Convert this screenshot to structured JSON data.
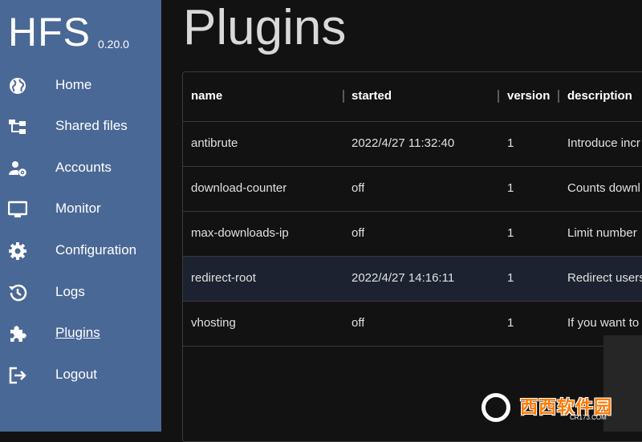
{
  "app": {
    "name": "HFS",
    "version": "0.20.0"
  },
  "sidebar": {
    "items": [
      {
        "label": "Home",
        "icon": "globe-icon"
      },
      {
        "label": "Shared files",
        "icon": "file-tree-icon"
      },
      {
        "label": "Accounts",
        "icon": "account-gear-icon"
      },
      {
        "label": "Monitor",
        "icon": "monitor-icon"
      },
      {
        "label": "Configuration",
        "icon": "gear-icon"
      },
      {
        "label": "Logs",
        "icon": "history-icon"
      },
      {
        "label": "Plugins",
        "icon": "puzzle-icon",
        "active": true
      },
      {
        "label": "Logout",
        "icon": "logout-icon"
      }
    ]
  },
  "main": {
    "title": "Plugins",
    "table": {
      "columns": [
        "name",
        "started",
        "version",
        "description"
      ],
      "rows": [
        {
          "name": "antibrute",
          "started": "2022/4/27 11:32:40",
          "version": "1",
          "description": "Introduce incr"
        },
        {
          "name": "download-counter",
          "started": "off",
          "version": "1",
          "description": "Counts downl"
        },
        {
          "name": "max-downloads-ip",
          "started": "off",
          "version": "1",
          "description": "Limit number"
        },
        {
          "name": "redirect-root",
          "started": "2022/4/27 14:16:11",
          "version": "1",
          "description": "Redirect users",
          "highlighted": true
        },
        {
          "name": "vhosting",
          "started": "off",
          "version": "1",
          "description": "If you want to"
        }
      ]
    }
  },
  "watermark": {
    "main": "西西软件园",
    "sub": "CR173.COM"
  },
  "colors": {
    "sidebar": "#4a6896",
    "background": "#121212",
    "row_highlight": "#1c2230"
  }
}
